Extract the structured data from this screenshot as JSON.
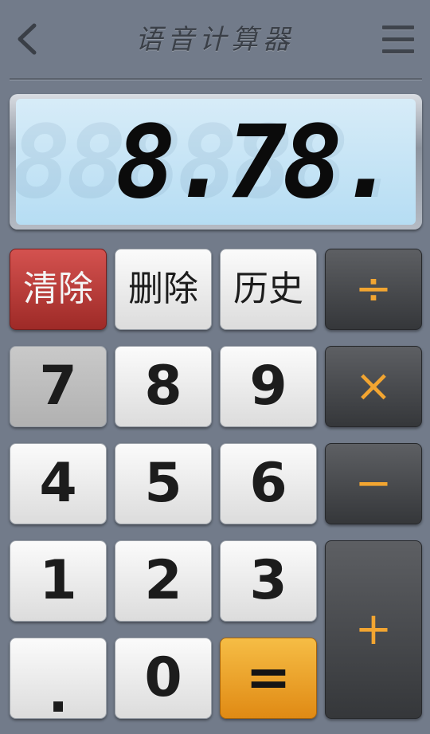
{
  "header": {
    "title": "语音计算器",
    "back_icon": "chevron-left-icon",
    "menu_icon": "hamburger-menu-icon"
  },
  "display": {
    "ghost": "88888888.",
    "value": "8.78."
  },
  "keys": {
    "clear": "清除",
    "delete": "删除",
    "history": "历史",
    "divide": "÷",
    "seven": "7",
    "eight": "8",
    "nine": "9",
    "multiply": "×",
    "four": "4",
    "five": "5",
    "six": "6",
    "minus": "−",
    "one": "1",
    "two": "2",
    "three": "3",
    "plus": "+",
    "dot": ".",
    "zero": "0",
    "equals": "="
  },
  "colors": {
    "background": "#727b8a",
    "operator_text": "#f2a531",
    "clear_key": "#c0403d",
    "equals_key": "#f0a02c",
    "display": "#c5e6f7"
  }
}
